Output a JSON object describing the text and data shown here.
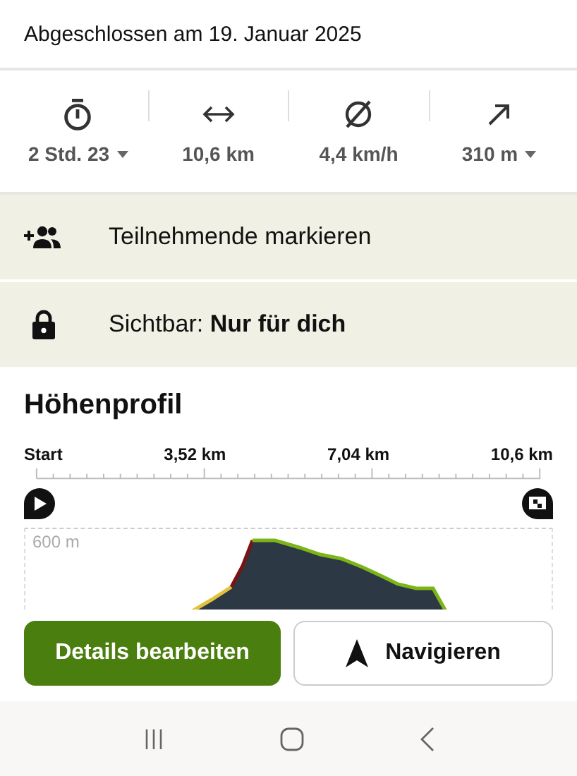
{
  "header": {
    "text": "Abgeschlossen am 19. Januar 2025"
  },
  "stats": [
    {
      "kind": "duration",
      "value": "2 Std. 23",
      "dropdown": true
    },
    {
      "kind": "distance",
      "value": "10,6 km",
      "dropdown": false
    },
    {
      "kind": "speed",
      "value": "4,4 km/h",
      "dropdown": false
    },
    {
      "kind": "ascent",
      "value": "310 m",
      "dropdown": true
    }
  ],
  "actions": [
    {
      "kind": "participants",
      "text": "Teilnehmende markieren"
    },
    {
      "kind": "visibility",
      "text": "Sichtbar: **Nur für dich**"
    }
  ],
  "elevation": {
    "title": "Höhenprofil",
    "axis_labels": [
      "Start",
      "3,52 km",
      "7,04 km",
      "10,6 km"
    ],
    "y_label": "600 m"
  },
  "buttons": [
    {
      "kind": "primary",
      "label": "Details bearbeiten"
    },
    {
      "kind": "navigate",
      "label": "Navigieren"
    }
  ]
}
